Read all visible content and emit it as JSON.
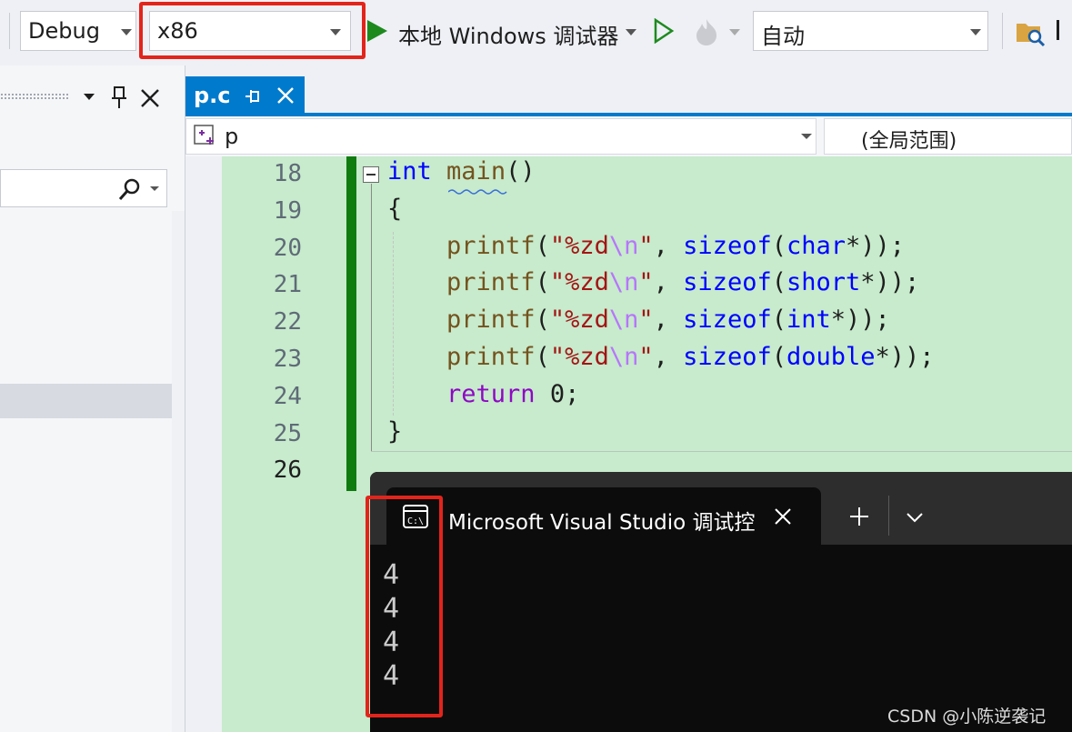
{
  "toolbar": {
    "config": "Debug",
    "platform": "x86",
    "debugger": "本地 Windows 调试器",
    "solution_config": "自动"
  },
  "tab": {
    "filename": "p.c"
  },
  "navbar": {
    "scope_left": "p",
    "scope_right": "(全局范围)"
  },
  "code": {
    "line_numbers": [
      "18",
      "19",
      "20",
      "21",
      "22",
      "23",
      "24",
      "25",
      "26"
    ],
    "lines": [
      [
        {
          "t": "int",
          "c": "kw"
        },
        {
          "t": " ",
          "c": "pl"
        },
        {
          "t": "main",
          "c": "fn"
        },
        {
          "t": "()",
          "c": "pl"
        }
      ],
      [
        {
          "t": "{",
          "c": "pl"
        }
      ],
      [
        {
          "t": "    ",
          "c": "pl"
        },
        {
          "t": "printf",
          "c": "fn"
        },
        {
          "t": "(",
          "c": "pl"
        },
        {
          "t": "\"%zd",
          "c": "str"
        },
        {
          "t": "\\n",
          "c": "esc"
        },
        {
          "t": "\"",
          "c": "str"
        },
        {
          "t": ", ",
          "c": "pl"
        },
        {
          "t": "sizeof",
          "c": "kw"
        },
        {
          "t": "(",
          "c": "pl"
        },
        {
          "t": "char",
          "c": "kw"
        },
        {
          "t": "*));",
          "c": "pl"
        }
      ],
      [
        {
          "t": "    ",
          "c": "pl"
        },
        {
          "t": "printf",
          "c": "fn"
        },
        {
          "t": "(",
          "c": "pl"
        },
        {
          "t": "\"%zd",
          "c": "str"
        },
        {
          "t": "\\n",
          "c": "esc"
        },
        {
          "t": "\"",
          "c": "str"
        },
        {
          "t": ", ",
          "c": "pl"
        },
        {
          "t": "sizeof",
          "c": "kw"
        },
        {
          "t": "(",
          "c": "pl"
        },
        {
          "t": "short",
          "c": "kw"
        },
        {
          "t": "*));",
          "c": "pl"
        }
      ],
      [
        {
          "t": "    ",
          "c": "pl"
        },
        {
          "t": "printf",
          "c": "fn"
        },
        {
          "t": "(",
          "c": "pl"
        },
        {
          "t": "\"%zd",
          "c": "str"
        },
        {
          "t": "\\n",
          "c": "esc"
        },
        {
          "t": "\"",
          "c": "str"
        },
        {
          "t": ", ",
          "c": "pl"
        },
        {
          "t": "sizeof",
          "c": "kw"
        },
        {
          "t": "(",
          "c": "pl"
        },
        {
          "t": "int",
          "c": "kw"
        },
        {
          "t": "*));",
          "c": "pl"
        }
      ],
      [
        {
          "t": "    ",
          "c": "pl"
        },
        {
          "t": "printf",
          "c": "fn"
        },
        {
          "t": "(",
          "c": "pl"
        },
        {
          "t": "\"%zd",
          "c": "str"
        },
        {
          "t": "\\n",
          "c": "esc"
        },
        {
          "t": "\"",
          "c": "str"
        },
        {
          "t": ", ",
          "c": "pl"
        },
        {
          "t": "sizeof",
          "c": "kw"
        },
        {
          "t": "(",
          "c": "pl"
        },
        {
          "t": "double",
          "c": "kw"
        },
        {
          "t": "*));",
          "c": "pl"
        }
      ],
      [
        {
          "t": "    ",
          "c": "pl"
        },
        {
          "t": "return",
          "c": "ret"
        },
        {
          "t": " 0;",
          "c": "pl"
        }
      ],
      [
        {
          "t": "}",
          "c": "pl"
        }
      ],
      []
    ]
  },
  "console": {
    "title": "Microsoft Visual Studio 调试控",
    "output": [
      "4",
      "4",
      "4",
      "4"
    ]
  },
  "watermark": "CSDN @小陈逆袭记",
  "colors": {
    "highlight": "#e3241b",
    "editor_bg": "#c7ebcc",
    "accent": "#007acc",
    "run_green": "#1e8a1e"
  }
}
